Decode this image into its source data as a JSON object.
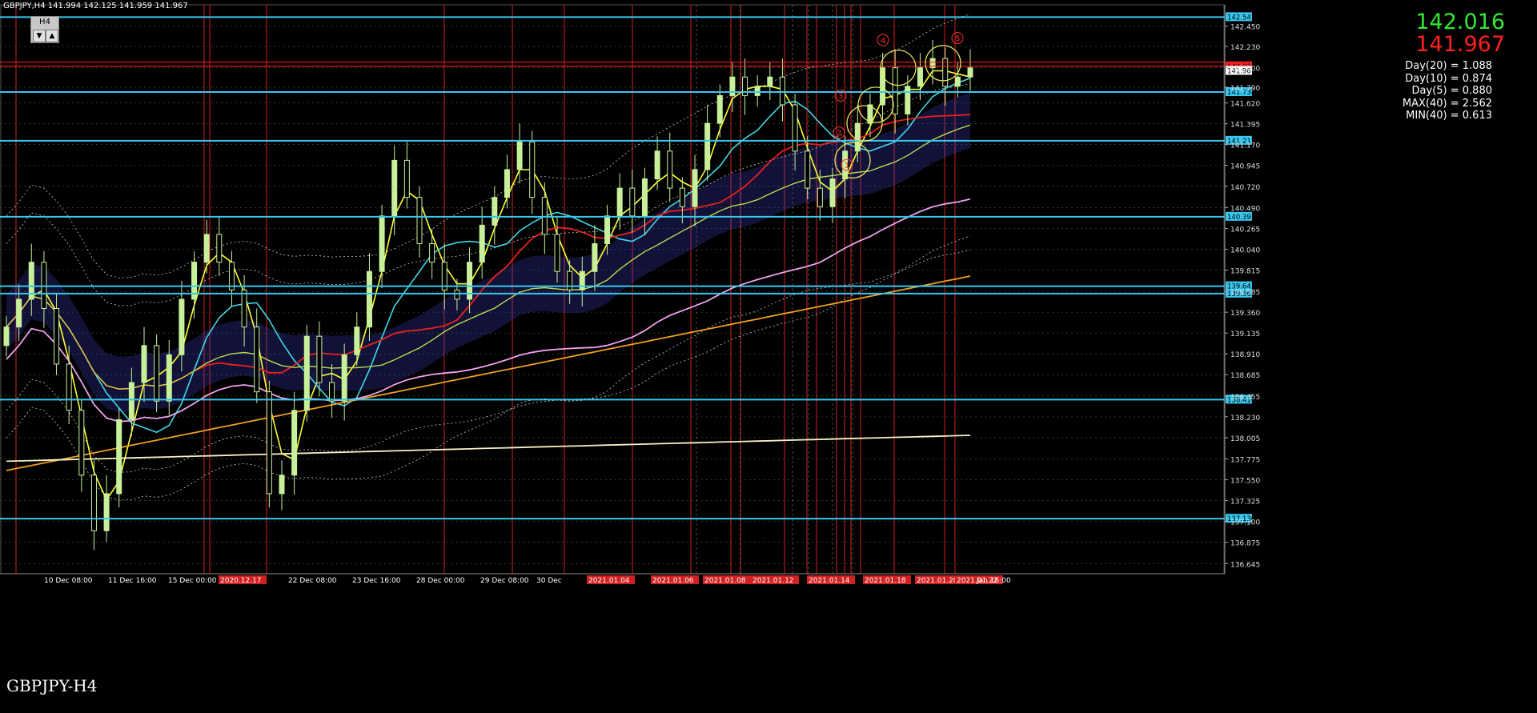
{
  "window": {
    "header": "GBPJPY,H4  141.994 142.125 141.959 141.967",
    "timeframe": "H4",
    "symbol_label": "GBPJPY-H4"
  },
  "quote": {
    "bid": "142.016",
    "ask": "141.967"
  },
  "stats": [
    "Day(20) = 1.088",
    "Day(10) = 0.874",
    "Day(5) = 0.880",
    "MAX(40) = 2.562",
    "MIN(40) = 0.613"
  ],
  "colors": {
    "background": "#000000",
    "grid": "#3a6b3a",
    "bull_candle": "#c8f09a",
    "bear_candle": "#4a9a2a",
    "vline": "#d02020",
    "hline": "#38c8ef",
    "resistance": "#ff2020",
    "ma_fast": "#ffff30",
    "ma_mid": "#40d8e8",
    "ma_red": "#e82020",
    "ma_olive": "#b8d850",
    "ma_pink": "#f0a0f0",
    "ma_orange": "#f0a020",
    "ma_white": "#f8f0c8",
    "cloud": "#4040c8",
    "envelope": "#c8c8c8"
  },
  "chart_data": {
    "type": "candlestick",
    "symbol": "GBPJPY",
    "timeframe": "H4",
    "ylim": [
      136.535,
      142.68
    ],
    "y_ticks": [
      "142.450",
      "142.230",
      "142.000",
      "141.790",
      "141.620",
      "141.395",
      "141.170",
      "140.945",
      "140.720",
      "140.490",
      "140.265",
      "140.040",
      "139.815",
      "139.585",
      "139.360",
      "139.135",
      "138.910",
      "138.685",
      "138.455",
      "138.230",
      "138.005",
      "137.775",
      "137.550",
      "137.325",
      "137.100",
      "136.875",
      "136.645"
    ],
    "x_labels": [
      "10 Dec 08:00",
      "11 Dec 16:00",
      "15 Dec 00:00",
      "2020.12.17",
      "22 Dec 08:00",
      "23 Dec 16:00",
      "28 Dec 00:00",
      "29 Dec 08:00",
      "30 Dec",
      "2021.01.04",
      "2021.01.06",
      "2021.01.08",
      "2021.01.12",
      "2021.01.14",
      "2021.01.18",
      "2021.01.20",
      "2021.01.22",
      "Jan 16:00"
    ],
    "horizontal_levels": [
      {
        "label": "142.547",
        "value": 142.547,
        "color": "#38c8ef"
      },
      {
        "label": "142.016",
        "value": 142.016,
        "color": "#ff2020"
      },
      {
        "label": "141.738",
        "value": 141.738,
        "color": "#38c8ef"
      },
      {
        "label": "141.212",
        "value": 141.212,
        "color": "#38c8ef"
      },
      {
        "label": "140.391",
        "value": 140.391,
        "color": "#38c8ef"
      },
      {
        "label": "139.641",
        "value": 139.641,
        "color": "#38c8ef"
      },
      {
        "label": "139.561",
        "value": 139.561,
        "color": "#38c8ef"
      },
      {
        "label": "138.416",
        "value": 138.416,
        "color": "#38c8ef"
      },
      {
        "label": "137.130",
        "value": 137.13,
        "color": "#38c8ef"
      }
    ],
    "price_tags": [
      {
        "label": "141.967",
        "value": 141.967
      }
    ],
    "wave_labels": [
      "1",
      "2",
      "3",
      "4",
      "5"
    ],
    "closes": [
      139.2,
      139.5,
      139.9,
      139.4,
      138.8,
      138.3,
      137.6,
      137.0,
      137.4,
      138.2,
      138.6,
      139.0,
      138.4,
      138.9,
      139.5,
      139.9,
      140.2,
      139.9,
      139.6,
      139.2,
      138.5,
      137.4,
      137.6,
      138.3,
      139.1,
      138.6,
      138.4,
      138.9,
      139.2,
      139.8,
      140.4,
      141.0,
      140.6,
      140.1,
      139.9,
      139.6,
      139.5,
      139.9,
      140.3,
      140.6,
      140.9,
      141.2,
      140.6,
      140.2,
      139.8,
      139.6,
      139.8,
      140.1,
      140.4,
      140.7,
      140.4,
      140.8,
      141.1,
      140.7,
      140.5,
      140.9,
      141.4,
      141.7,
      141.9,
      141.7,
      141.8,
      141.9,
      141.6,
      141.1,
      140.7,
      140.5,
      140.8,
      141.1,
      141.4,
      141.6,
      142.0,
      141.5,
      141.8,
      142.0,
      142.1,
      141.8,
      141.9,
      142.0
    ]
  }
}
